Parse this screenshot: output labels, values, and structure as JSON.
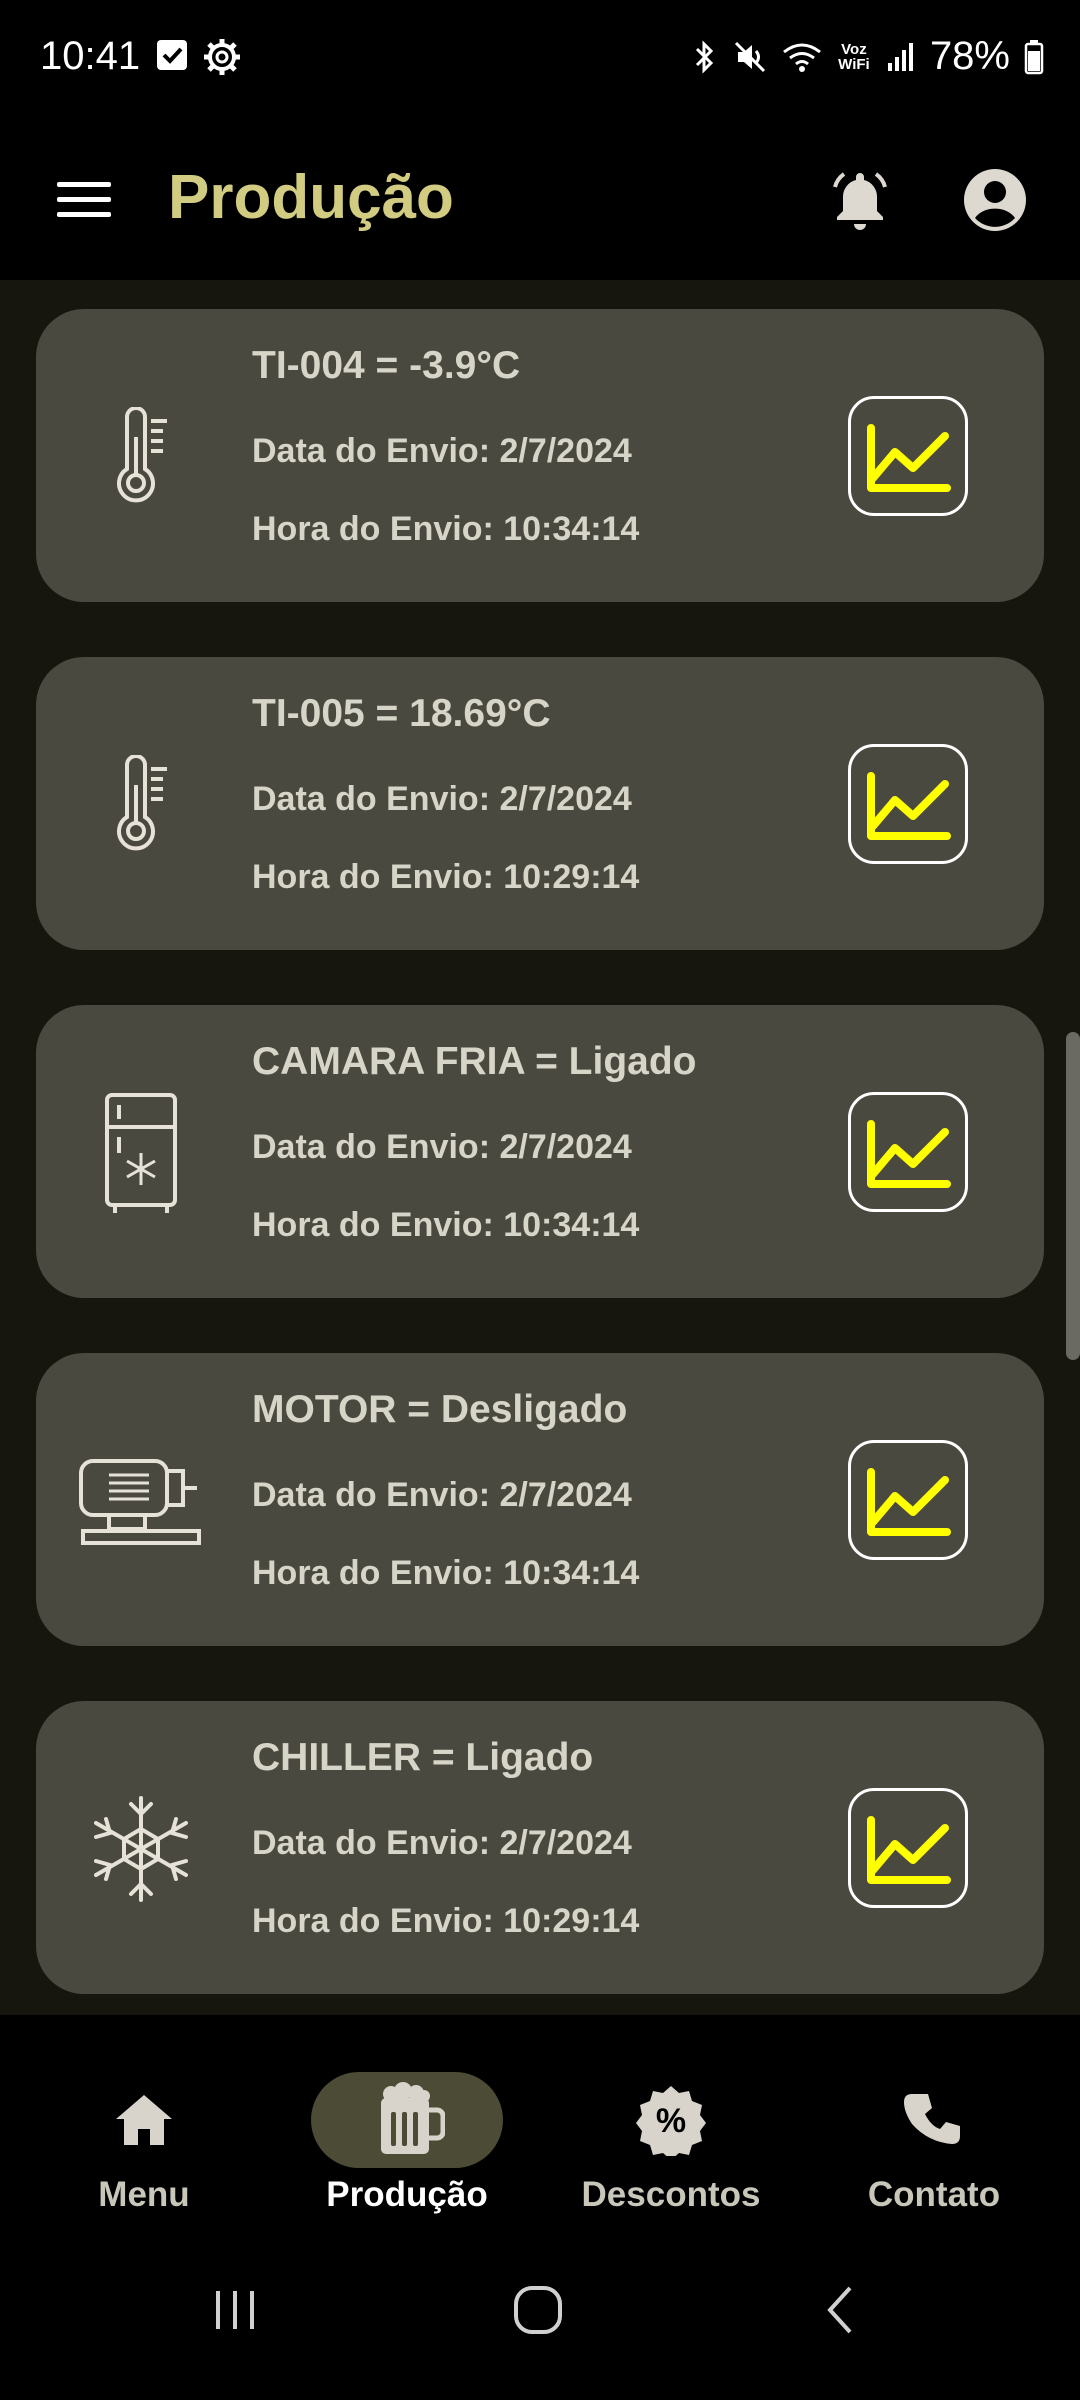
{
  "status_bar": {
    "time": "10:41",
    "battery": "78%",
    "network_label": "Voz WiFi"
  },
  "app_bar": {
    "title": "Produção"
  },
  "cards": [
    {
      "title": "TI-004 = -3.9°C",
      "date": "Data do Envio: 2/7/2024",
      "time": "Hora do Envio: 10:34:14",
      "icon": "thermometer-icon"
    },
    {
      "title": "TI-005 = 18.69°C",
      "date": "Data do Envio: 2/7/2024",
      "time": "Hora do Envio: 10:29:14",
      "icon": "thermometer-icon"
    },
    {
      "title": "CAMARA FRIA = Ligado",
      "date": "Data do Envio: 2/7/2024",
      "time": "Hora do Envio: 10:34:14",
      "icon": "refrigerator-icon"
    },
    {
      "title": "MOTOR = Desligado",
      "date": "Data do Envio: 2/7/2024",
      "time": "Hora do Envio: 10:34:14",
      "icon": "motor-icon"
    },
    {
      "title": "CHILLER = Ligado",
      "date": "Data do Envio: 2/7/2024",
      "time": "Hora do Envio: 10:29:14",
      "icon": "snowflake-icon"
    }
  ],
  "bottom_nav": {
    "items": [
      {
        "label": "Menu",
        "icon": "home-icon",
        "active": false
      },
      {
        "label": "Produção",
        "icon": "beer-mug-icon",
        "active": true
      },
      {
        "label": "Descontos",
        "icon": "discount-badge-icon",
        "active": false
      },
      {
        "label": "Contato",
        "icon": "phone-icon",
        "active": false
      }
    ]
  },
  "colors": {
    "title_accent": "#d2cc82",
    "card_bg": "#4a4940",
    "chart_line": "#ffff00",
    "content_bg": "#16160f",
    "active_pill": "#4c4b35"
  }
}
